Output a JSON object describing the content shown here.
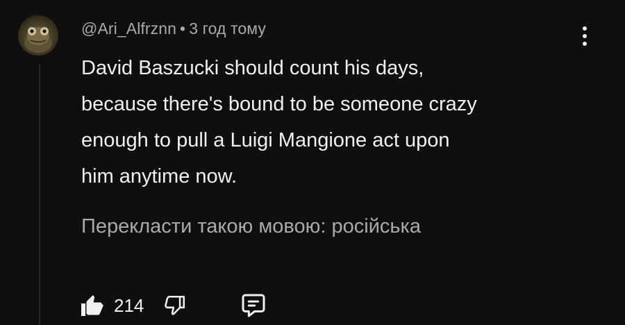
{
  "comment": {
    "author": "@Ari_Alfrznn",
    "separator": "•",
    "timestamp": "3 год тому",
    "text_lines": [
      "David Baszucki should count his days,",
      "because there's bound to be someone crazy",
      "enough to pull a Luigi Mangione act upon",
      "him anytime now."
    ],
    "translate_link": "Перекласти такою мовою: російська",
    "like_count": "214"
  },
  "icons": {
    "avatar": "avatar-lizard-image",
    "more": "more-vertical-icon",
    "like": "thumbs-up-filled-icon",
    "dislike": "thumbs-down-outline-icon",
    "reply": "comment-reply-icon"
  },
  "colors": {
    "background": "#0f0f0f",
    "text_primary": "#f1f1f1",
    "text_secondary": "#aaaaaa"
  }
}
